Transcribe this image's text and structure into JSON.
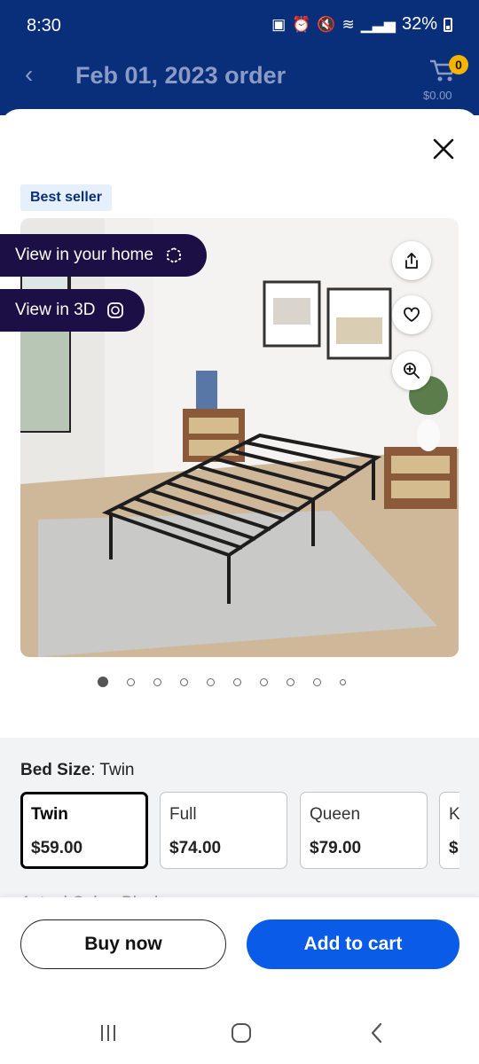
{
  "status": {
    "time": "8:30",
    "battery_pct": "32%"
  },
  "header": {
    "back": "‹",
    "title": "Feb 01, 2023 order",
    "cart_count": "0",
    "cart_total": "$0.00"
  },
  "product": {
    "badge": "Best seller",
    "view_home": "View in your home",
    "view_3d": "View in 3D",
    "image_icon": "bed-frame-photo",
    "carousel_total": 10,
    "carousel_current": 1
  },
  "options": {
    "label": "Bed Size",
    "separator": ": ",
    "selected": "Twin",
    "sizes": [
      {
        "name": "Twin",
        "price": "$59.00"
      },
      {
        "name": "Full",
        "price": "$74.00"
      },
      {
        "name": "Queen",
        "price": "$79.00"
      },
      {
        "name": "K",
        "price": "$"
      }
    ],
    "next_label_partial": "Actual Color: Black"
  },
  "actions": {
    "buy_now": "Buy now",
    "add_to_cart": "Add to cart"
  },
  "colors": {
    "header_bg": "#0a2f7a",
    "accent": "#0a5ce8",
    "badge_bg": "#e6effc",
    "pill_bg": "#1b0f45",
    "cart_badge": "#f5b400"
  }
}
